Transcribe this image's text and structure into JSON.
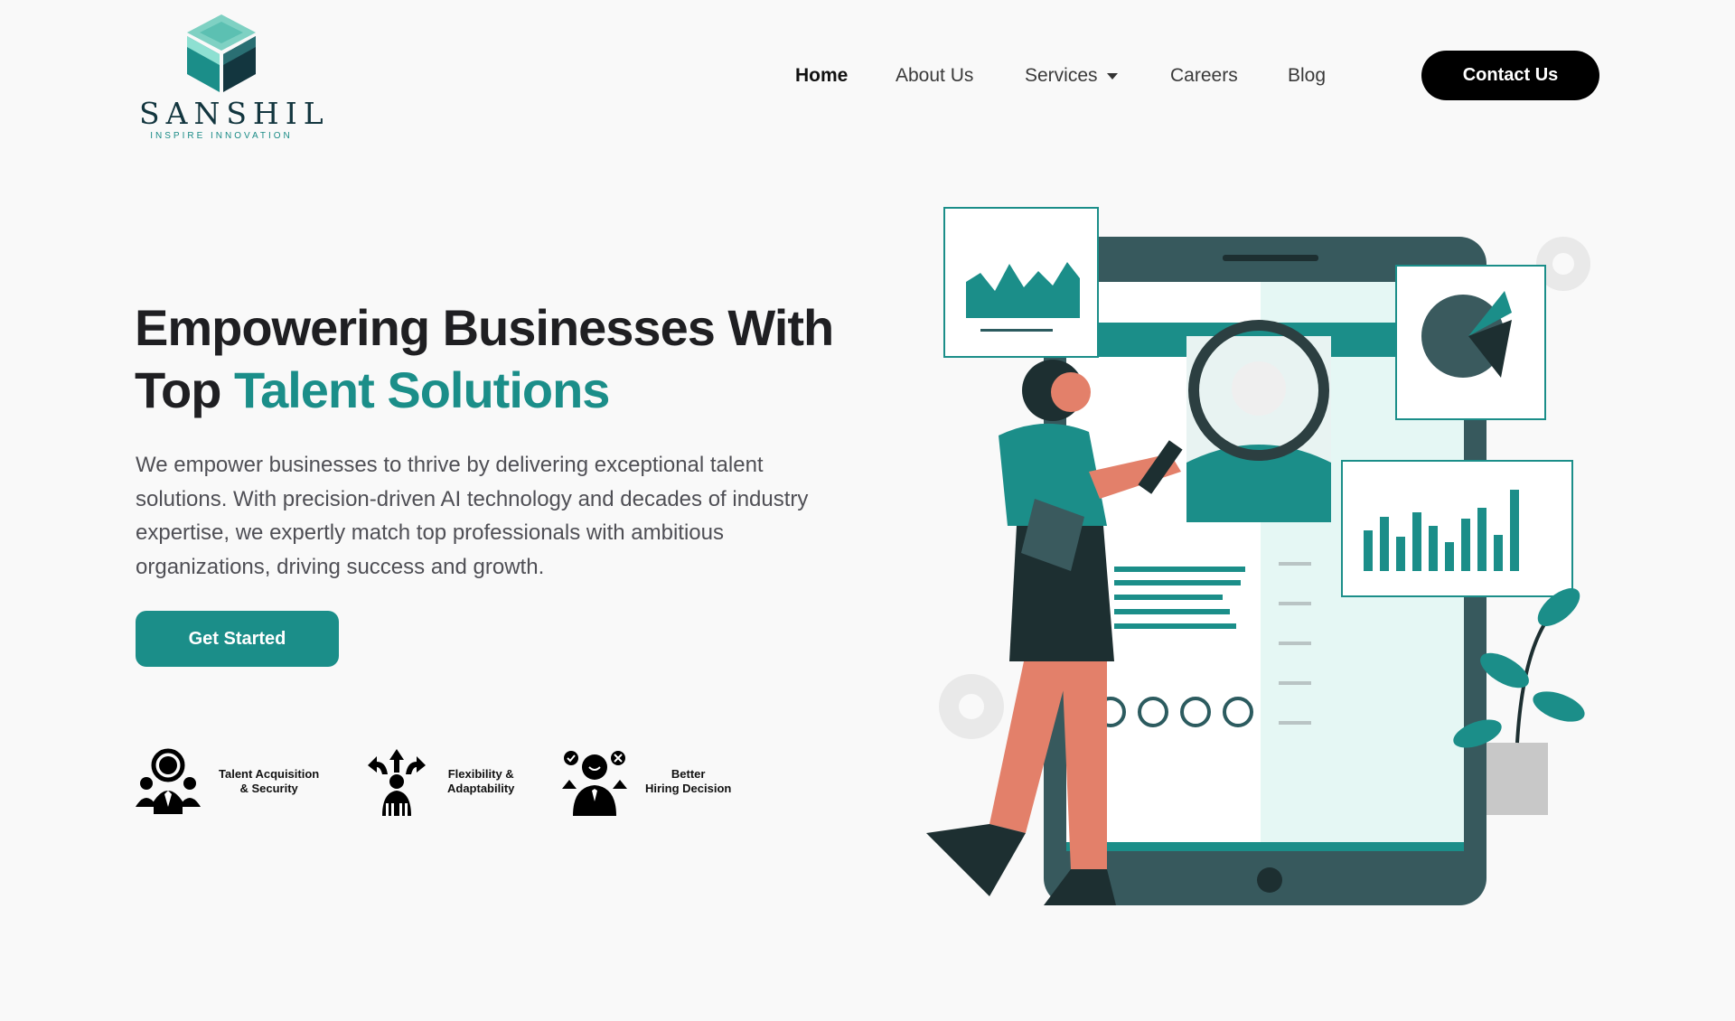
{
  "brand": {
    "name": "SANSHIL",
    "tagline": "INSPIRE INNOVATION",
    "colors": {
      "teal": "#1b8e89",
      "dark_teal": "#13363f",
      "light_teal": "#7fd1c3",
      "black": "#000000"
    }
  },
  "nav": {
    "items": [
      {
        "label": "Home",
        "active": true
      },
      {
        "label": "About Us"
      },
      {
        "label": "Services",
        "has_dropdown": true
      },
      {
        "label": "Careers"
      },
      {
        "label": "Blog"
      }
    ],
    "contact_label": "Contact Us"
  },
  "hero": {
    "title_line1": "Empowering Businesses With",
    "title_line2_prefix": "Top ",
    "title_line2_accent": "Talent Solutions",
    "description": "We empower businesses to thrive by delivering exceptional talent solutions. With precision-driven AI technology and decades of industry expertise, we expertly match top professionals with ambitious organizations, driving success and growth.",
    "cta_label": "Get Started"
  },
  "features": [
    {
      "icon": "talent-acquisition-icon",
      "label": "Talent Acquisition\n& Security"
    },
    {
      "icon": "flexibility-icon",
      "label": "Flexibility &\nAdaptability"
    },
    {
      "icon": "hiring-decision-icon",
      "label": "Better\nHiring Decision"
    }
  ],
  "illustration": {
    "subject": "recruiter-with-magnifier-illustration"
  }
}
